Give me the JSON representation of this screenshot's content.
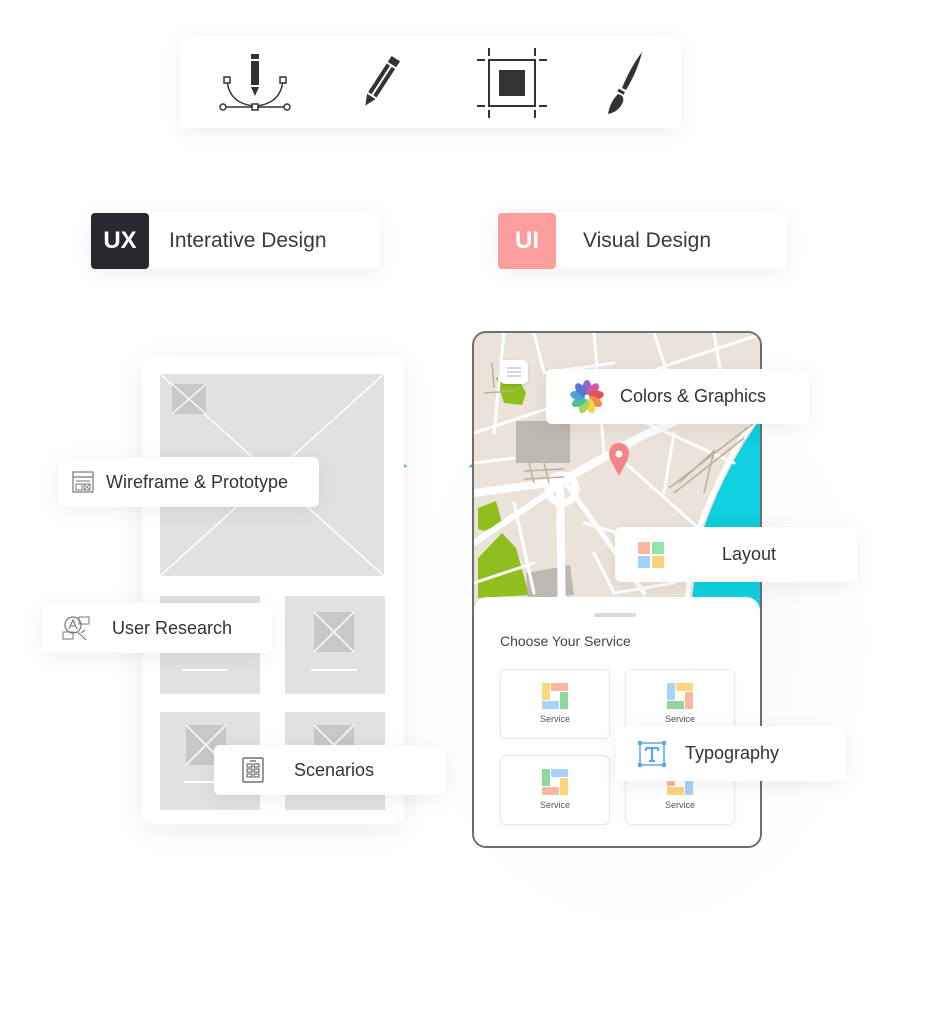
{
  "toolbar": {
    "tools": [
      {
        "icon": "pen-bezier-tool-icon"
      },
      {
        "icon": "pencil-icon"
      },
      {
        "icon": "artboard-crop-icon"
      },
      {
        "icon": "paintbrush-icon"
      }
    ]
  },
  "tags": {
    "ux": {
      "badge": "UX",
      "label": "Interative Design",
      "color": "#282830"
    },
    "ui": {
      "badge": "UI",
      "label": "Visual Design",
      "color": "#fc9e9e"
    }
  },
  "ux_labels": {
    "wireframe": "Wireframe & Prototype",
    "research": "User Research",
    "scenarios": "Scenarios"
  },
  "ui_labels": {
    "colors": "Colors & Graphics",
    "layout": "Layout",
    "typography": "Typography"
  },
  "phone": {
    "sheet_title": "Choose Your Service",
    "services": [
      "Service",
      "Service",
      "Service",
      "Service"
    ]
  },
  "colors": {
    "map_water": "#0fcfe0",
    "map_green": "#8fbf1f",
    "map_pin": "#f5848a",
    "connector": "#59a7e6",
    "type_icon": "#5aa9ea"
  }
}
